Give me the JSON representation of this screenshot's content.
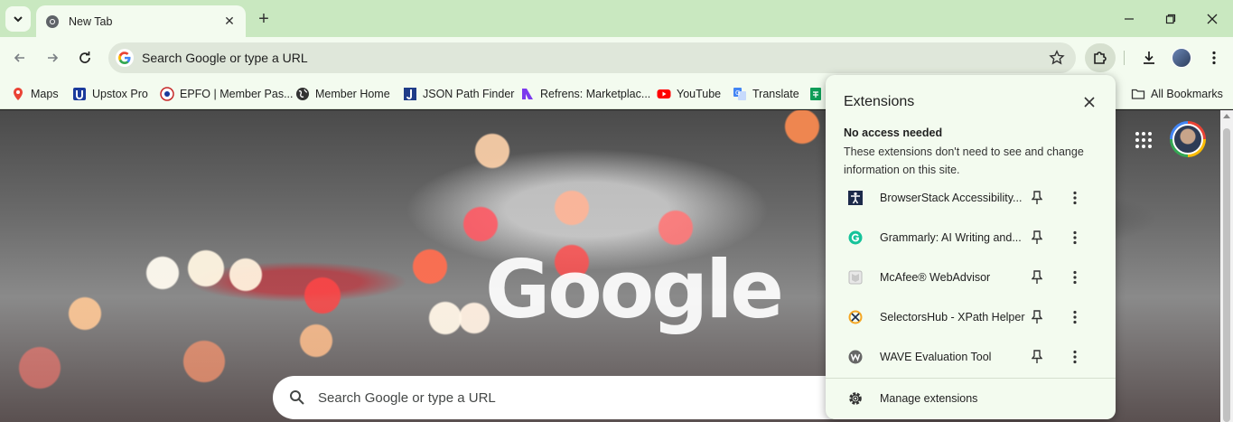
{
  "tab": {
    "title": "New Tab",
    "close_glyph": "✕"
  },
  "newtab_glyph": "+",
  "toolbar": {
    "omnibox_text": "Search Google or type a URL"
  },
  "bookmarks": [
    {
      "label": "Maps",
      "icon": "maps-icon"
    },
    {
      "label": "Upstox Pro",
      "icon": "upstox-icon"
    },
    {
      "label": "EPFO | Member Pas...",
      "icon": "epfo-icon"
    },
    {
      "label": "Member Home",
      "icon": "globe-icon"
    },
    {
      "label": "JSON Path Finder",
      "icon": "json-icon"
    },
    {
      "label": "Refrens: Marketplac...",
      "icon": "refrens-icon"
    },
    {
      "label": "YouTube",
      "icon": "youtube-icon"
    },
    {
      "label": "Translate",
      "icon": "translate-icon"
    }
  ],
  "all_bookmarks": "All Bookmarks",
  "ntp": {
    "logo": "Google",
    "search_text": "Search Google or type a URL"
  },
  "extensions_panel": {
    "title": "Extensions",
    "close_glyph": "✕",
    "section_title": "No access needed",
    "section_desc": "These extensions don't need to see and change information on this site.",
    "items": [
      {
        "name": "BrowserStack Accessibility...",
        "icon": "browserstack-icon"
      },
      {
        "name": "Grammarly: AI Writing and...",
        "icon": "grammarly-icon"
      },
      {
        "name": "McAfee® WebAdvisor",
        "icon": "mcafee-icon"
      },
      {
        "name": "SelectorsHub - XPath Helper",
        "icon": "selectorshub-icon"
      },
      {
        "name": "WAVE Evaluation Tool",
        "icon": "wave-icon"
      }
    ],
    "manage": "Manage extensions"
  },
  "colors": {
    "chrome_frame": "#c9e8c0",
    "toolbar_bg": "#f3fbef",
    "omnibox_bg": "#dfe7da"
  }
}
